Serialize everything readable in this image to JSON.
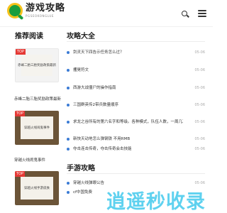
{
  "header": {
    "logo_cn": "游戏攻略",
    "logo_en": "PGSEOKONGLUE",
    "search_icon": "search-icon",
    "menu_icon": "menu-icon"
  },
  "recommend": {
    "title": "推荐阅读",
    "cards": [
      {
        "badge": "TOP",
        "image_text": "赤峰二胎三胎奖励政策最新",
        "caption": "赤峰二胎三胎奖励政策最新"
      },
      {
        "badge": "TOP",
        "image_text": "穿越火线闹鬼事件",
        "caption": "穿越火线闹鬼事件"
      },
      {
        "badge": "TOP",
        "image_text": "穿越火线手游皮肤",
        "caption": ""
      }
    ]
  },
  "strategy": {
    "title": "攻略大全",
    "items": [
      {
        "title": "剑灵天下四告示任务怎么过？",
        "date": "05-06"
      },
      {
        "title": "攫晃符文",
        "date": "05-06"
      },
      {
        "title": "西游大战僵尸的操作指南",
        "date": "05-06"
      },
      {
        "title": "三国群英传2带兵数量顺序",
        "date": "05-06"
      },
      {
        "title": "求龙之谷所有的第六名字和等级。各种模式，队伍人数，一周几次的",
        "date": "05-06"
      },
      {
        "title": "新快天动地怎么弹钢铁 不用RMB",
        "date": "05-06"
      },
      {
        "title": "夺击连击传奇，夺击传奇会击技能",
        "date": "05-06"
      }
    ]
  },
  "mobile": {
    "title": "手游攻略",
    "items": [
      {
        "title": "穿越火线弹眼公告",
        "date": "05-06"
      },
      {
        "title": "cf中国免费",
        "date": ""
      }
    ]
  },
  "watermark": "逍遥秒收录",
  "colors": {
    "accent_blue": "#3a7bd5",
    "badge_red": "#e53935",
    "logo_green": "#1a9e3e",
    "logo_yellow": "#f6c21b",
    "watermark_cyan": "#42c9ec"
  }
}
